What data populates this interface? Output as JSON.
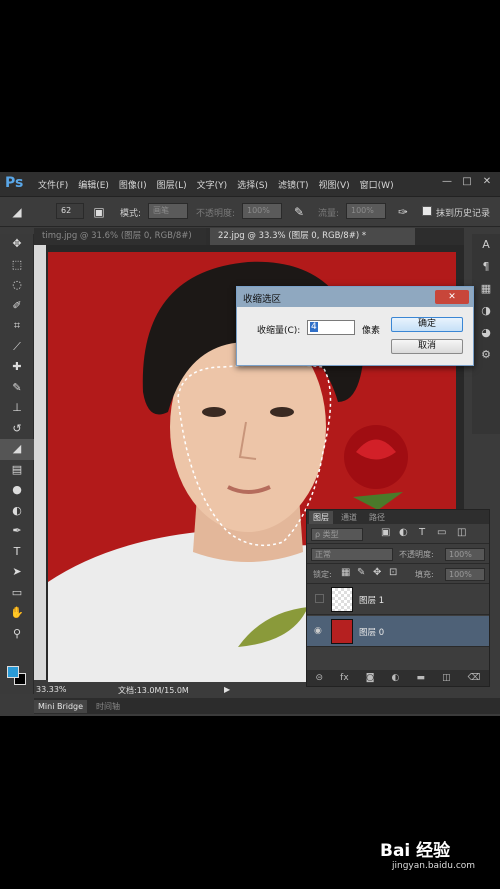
{
  "app": {
    "logo": "Ps"
  },
  "menu": [
    "文件(F)",
    "编辑(E)",
    "图像(I)",
    "图层(L)",
    "文字(Y)",
    "选择(S)",
    "滤镜(T)",
    "视图(V)",
    "窗口(W)"
  ],
  "window_controls": [
    "—",
    "□",
    "✕"
  ],
  "options": {
    "brush_size": "62",
    "mode_label": "模式:",
    "mode_value": "画笔",
    "opacity_label": "不透明度:",
    "opacity_value": "100%",
    "flow_label": "流量:",
    "flow_value": "100%",
    "erase_history_label": "抹到历史记录"
  },
  "tabs": {
    "inactive": "timg.jpg @ 31.6% (图层 0, RGB/8#)",
    "active": "22.jpg @ 33.3% (图层 0, RGB/8#) *"
  },
  "status": {
    "zoom": "33.33%",
    "doc": "文档:13.0M/15.0M"
  },
  "bottom_tabs": {
    "bridge": "Mini Bridge",
    "timeline": "时间轴"
  },
  "dialog": {
    "title": "收缩选区",
    "label": "收缩量(C):",
    "value": "4",
    "unit": "像素",
    "ok": "确定",
    "cancel": "取消"
  },
  "layers_panel": {
    "tabs": [
      "图层",
      "通道",
      "路径"
    ],
    "filter_label": "ρ 类型",
    "blend_mode": "正常",
    "opacity_label": "不透明度:",
    "opacity_value": "100%",
    "lock_label": "锁定:",
    "fill_label": "填充:",
    "fill_value": "100%",
    "layers": [
      {
        "name": "图层 1",
        "visible": false,
        "selected": false
      },
      {
        "name": "图层 0",
        "visible": true,
        "selected": true
      }
    ],
    "footer_icons": [
      "link-icon",
      "fx-icon",
      "mask-icon",
      "adjustment-icon",
      "folder-icon",
      "new-layer-icon",
      "trash-icon"
    ]
  },
  "watermark": {
    "logo": "Bai 经验",
    "url": "jingyan.baidu.com"
  }
}
